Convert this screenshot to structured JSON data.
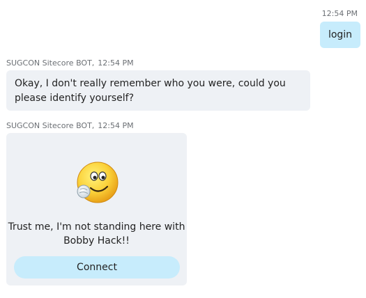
{
  "outgoing": {
    "time": "12:54 PM",
    "text": "login"
  },
  "messages": [
    {
      "sender": "SUGCON Sitecore BOT,",
      "time": "12:54 PM",
      "text": "Okay, I don't really remember who you were, could you please identify yourself?"
    },
    {
      "sender": "SUGCON Sitecore BOT,",
      "time": "12:54 PM",
      "card": {
        "icon": "smirk-emoji-icon",
        "text_line1": "Trust me, I'm not standing here with",
        "text_line2": "Bobby Hack!!",
        "button_label": "Connect"
      }
    }
  ],
  "colors": {
    "outgoing_bubble": "#c7ecfc",
    "incoming_bubble": "#eef1f5",
    "button": "#c7ecfc",
    "meta_text": "#6b6f74"
  }
}
